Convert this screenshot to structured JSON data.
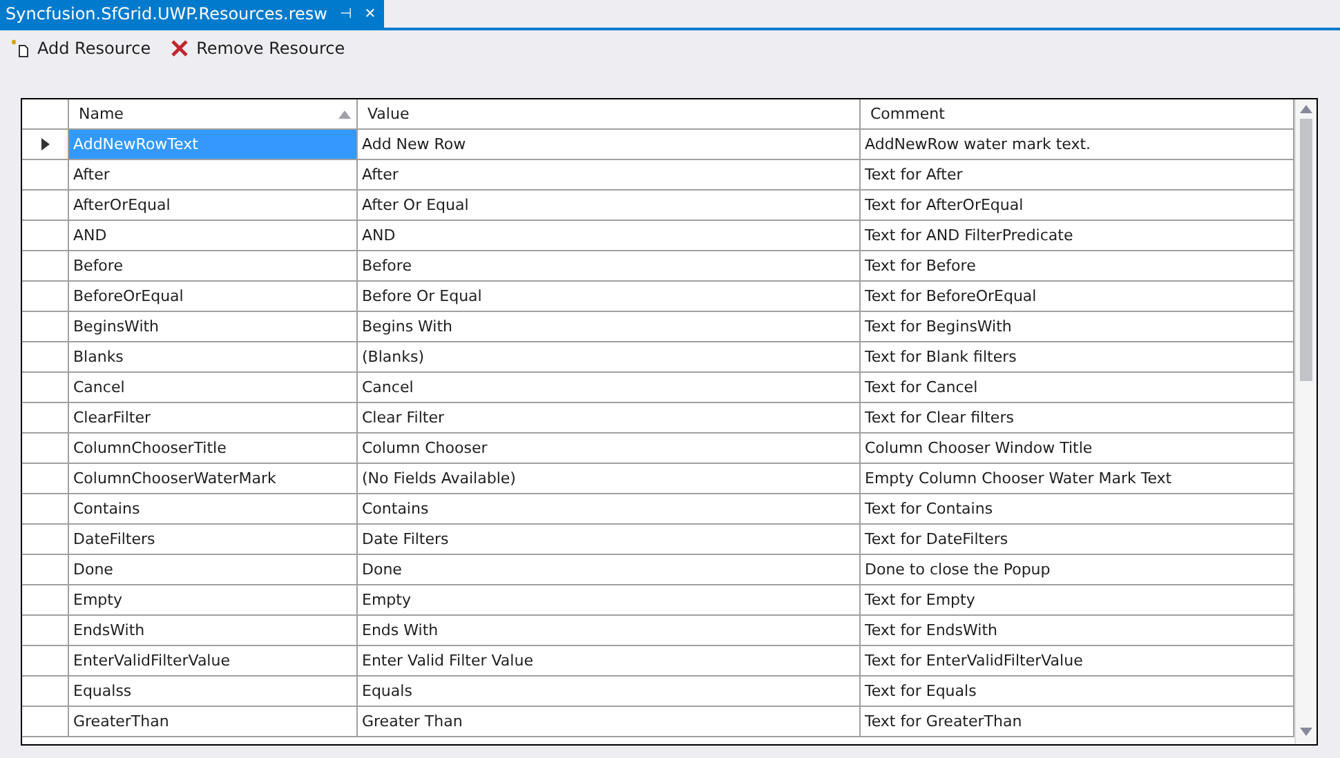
{
  "tab": {
    "title": "Syncfusion.SfGrid.UWP.Resources.resw",
    "pin": "⊣",
    "close": "✕"
  },
  "toolbar": [
    "Add Resource",
    "Remove Resource"
  ],
  "table": {
    "columns": [
      {
        "label": "Name",
        "sorted": true
      },
      {
        "label": "Value",
        "sorted": false
      },
      {
        "label": "Comment",
        "sorted": false
      }
    ],
    "rows": [
      {
        "selected": true,
        "cells": [
          "AddNewRowText",
          "Add New Row",
          "AddNewRow water mark text."
        ]
      },
      {
        "selected": false,
        "cells": [
          "After",
          "After",
          "Text for After"
        ]
      },
      {
        "selected": false,
        "cells": [
          "AfterOrEqual",
          "After Or Equal",
          "Text for AfterOrEqual"
        ]
      },
      {
        "selected": false,
        "cells": [
          "AND",
          "AND",
          "Text for AND FilterPredicate"
        ]
      },
      {
        "selected": false,
        "cells": [
          "Before",
          "Before",
          "Text for Before"
        ]
      },
      {
        "selected": false,
        "cells": [
          "BeforeOrEqual",
          "Before Or Equal",
          "Text for BeforeOrEqual"
        ]
      },
      {
        "selected": false,
        "cells": [
          "BeginsWith",
          "Begins With",
          "Text for BeginsWith"
        ]
      },
      {
        "selected": false,
        "cells": [
          "Blanks",
          "(Blanks)",
          "Text for Blank filters"
        ]
      },
      {
        "selected": false,
        "cells": [
          "Cancel",
          "Cancel",
          "Text for Cancel"
        ]
      },
      {
        "selected": false,
        "cells": [
          "ClearFilter",
          "Clear Filter",
          "Text for Clear filters"
        ]
      },
      {
        "selected": false,
        "cells": [
          "ColumnChooserTitle",
          "Column Chooser",
          "Column Chooser Window Title"
        ]
      },
      {
        "selected": false,
        "cells": [
          "ColumnChooserWaterMark",
          "(No Fields Available)",
          "Empty Column Chooser Water Mark Text"
        ]
      },
      {
        "selected": false,
        "cells": [
          "Contains",
          "Contains",
          "Text for Contains"
        ]
      },
      {
        "selected": false,
        "cells": [
          "DateFilters",
          "Date Filters",
          "Text for DateFilters"
        ]
      },
      {
        "selected": false,
        "cells": [
          "Done",
          "Done",
          "Done to close the Popup"
        ]
      },
      {
        "selected": false,
        "cells": [
          "Empty",
          "Empty",
          "Text for Empty"
        ]
      },
      {
        "selected": false,
        "cells": [
          "EndsWith",
          "Ends With",
          "Text for EndsWith"
        ]
      },
      {
        "selected": false,
        "cells": [
          "EnterValidFilterValue",
          "Enter Valid Filter Value",
          "Text for EnterValidFilterValue"
        ]
      },
      {
        "selected": false,
        "cells": [
          "Equalss",
          "Equals",
          "Text for Equals"
        ]
      },
      {
        "selected": false,
        "cells": [
          "GreaterThan",
          "Greater Than",
          "Text for GreaterThan"
        ]
      }
    ]
  }
}
